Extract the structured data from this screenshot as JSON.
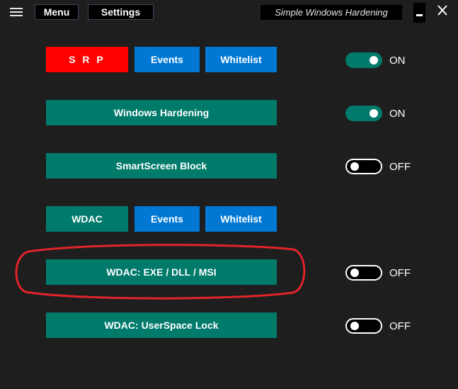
{
  "titlebar": {
    "menu_label": "Menu",
    "settings_label": "Settings",
    "app_title": "Simple Windows Hardening"
  },
  "srp_row": {
    "srp_label": "S R P",
    "events_label": "Events",
    "whitelist_label": "Whitelist",
    "state_label": "ON",
    "state": "on"
  },
  "hardening_row": {
    "label": "Windows Hardening",
    "state_label": "ON",
    "state": "on"
  },
  "smartscreen_row": {
    "label": "SmartScreen Block",
    "state_label": "OFF",
    "state": "off"
  },
  "wdac_row": {
    "wdac_label": "WDAC",
    "events_label": "Events",
    "whitelist_label": "Whitelist"
  },
  "wdac_exe_row": {
    "label": "WDAC:  EXE / DLL / MSI",
    "state_label": "OFF",
    "state": "off",
    "highlighted": true
  },
  "wdac_userspace_row": {
    "label": "WDAC:  UserSpace Lock",
    "state_label": "OFF",
    "state": "off"
  },
  "colors": {
    "background": "#1e1e1e",
    "teal": "#007a6b",
    "blue": "#0078d4",
    "red": "#ff0000",
    "highlight": "#e0242a"
  },
  "icons": {
    "hamburger": "hamburger-icon",
    "minimize": "minimize-icon",
    "close": "close-icon"
  }
}
